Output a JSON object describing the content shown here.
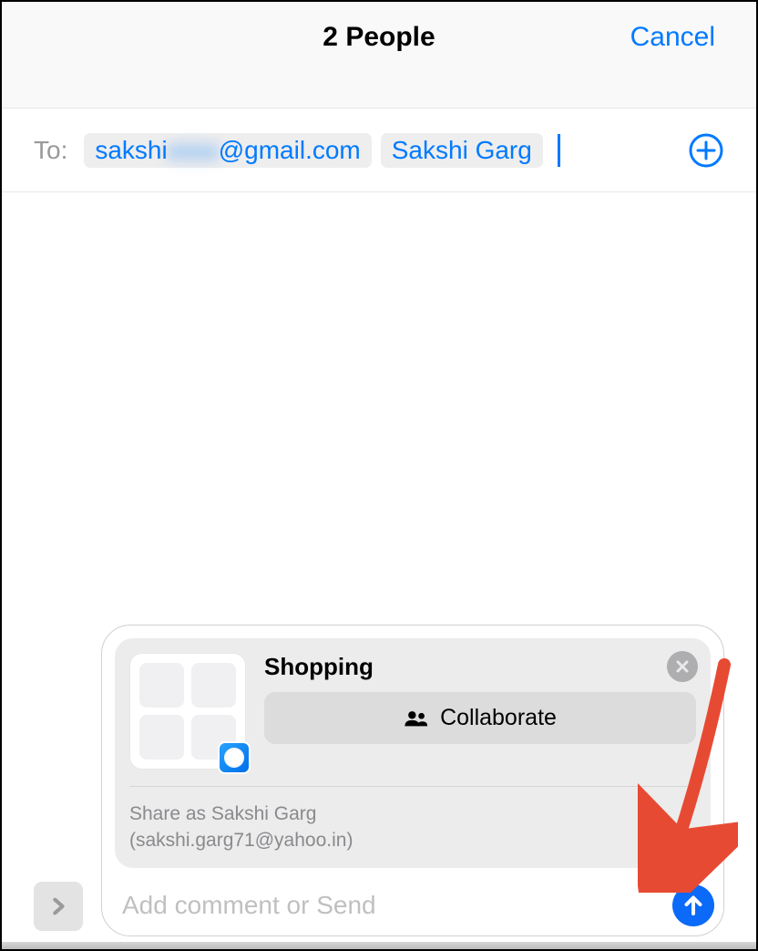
{
  "header": {
    "title": "2 People",
    "cancel_label": "Cancel"
  },
  "to": {
    "label": "To:",
    "contacts": [
      {
        "display": "sakshi",
        "blurred": "xxxx",
        "suffix": "@gmail.com"
      },
      {
        "display": "Sakshi Garg"
      }
    ]
  },
  "share_card": {
    "title": "Shopping",
    "collaborate_label": "Collaborate",
    "share_as_line1": "Share as Sakshi Garg",
    "share_as_line2": "(sakshi.garg71@yahoo.in)"
  },
  "compose": {
    "placeholder": "Add comment or Send"
  }
}
